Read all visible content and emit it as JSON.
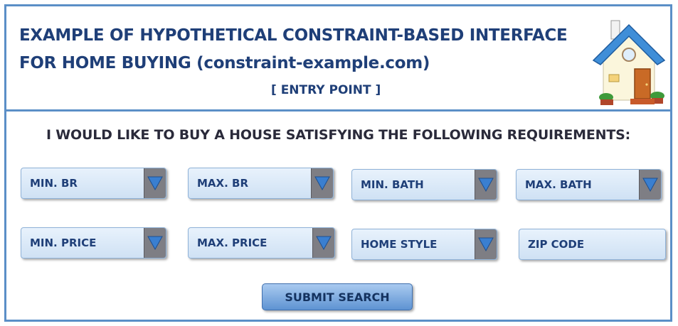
{
  "header": {
    "title_line1": "EXAMPLE OF HYPOTHETICAL CONSTRAINT-BASED INTERFACE",
    "title_line2": "FOR HOME BUYING (constraint-example.com)",
    "entry_point": "[ ENTRY POINT ]"
  },
  "prompt": "I WOULD LIKE TO BUY A HOUSE SATISFYING THE FOLLOWING REQUIREMENTS:",
  "fields": {
    "min_br": "MIN. BR",
    "max_br": "MAX. BR",
    "min_bath": "MIN. BATH",
    "max_bath": "MAX. BATH",
    "min_price": "MIN. PRICE",
    "max_price": "MAX. PRICE",
    "home_style": "HOME STYLE",
    "zip_code": "ZIP CODE"
  },
  "submit_label": "SUBMIT SEARCH",
  "colors": {
    "accent": "#5b8fc7",
    "text": "#1f3f78",
    "dropdown_arrow": "#3a7fd0"
  }
}
